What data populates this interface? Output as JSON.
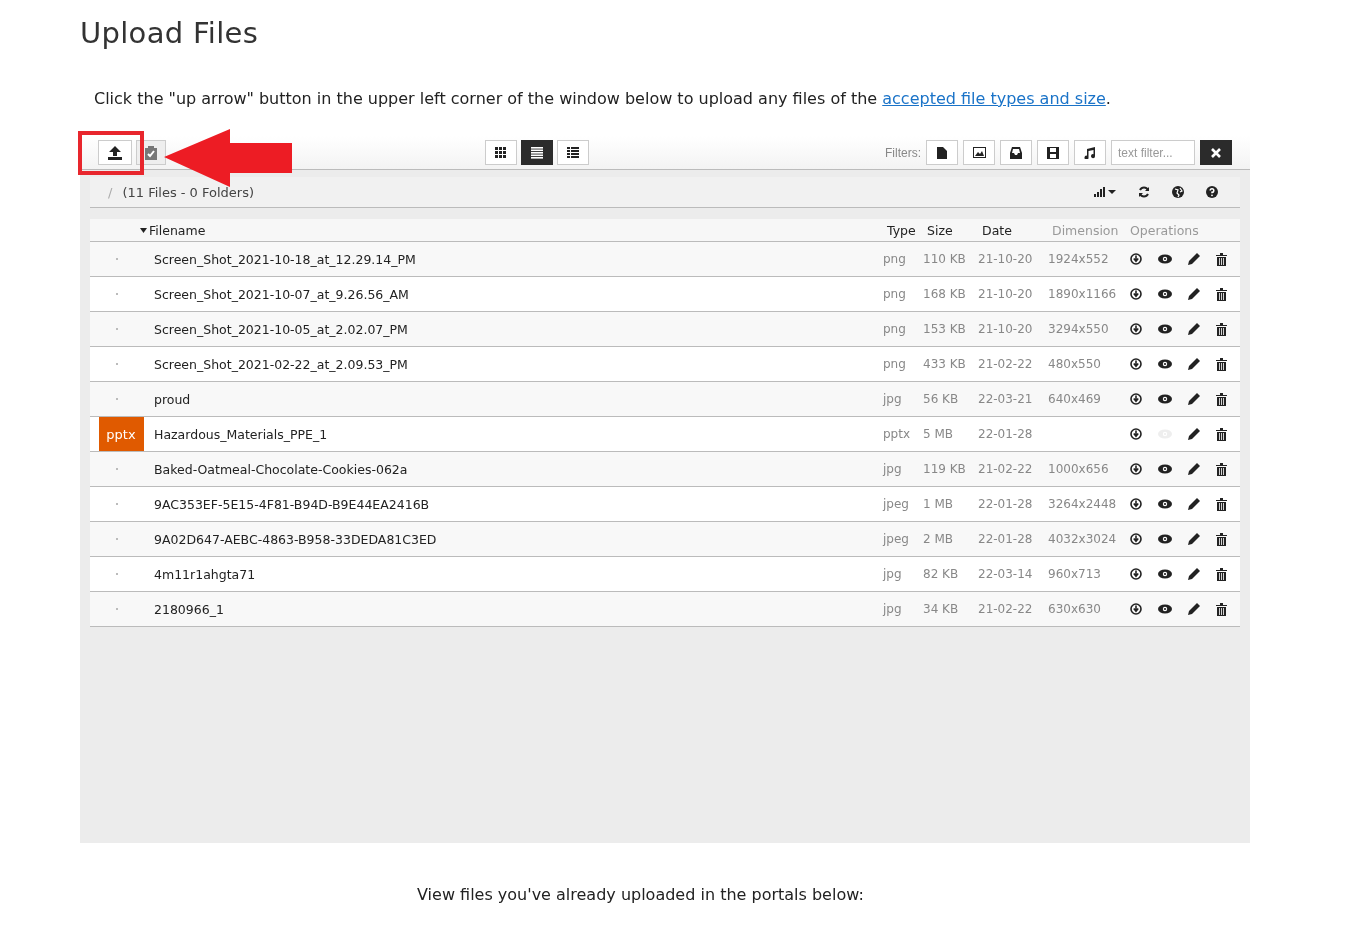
{
  "title": "Upload Files",
  "instruction": {
    "text": "Click the \"up arrow\" button in the upper left corner of the window below to upload any files of the ",
    "link": "accepted file types and size",
    "end": "."
  },
  "toolbar": {
    "view_modes": [
      {
        "kind": "grid",
        "selected": false
      },
      {
        "kind": "list",
        "selected": true
      },
      {
        "kind": "details",
        "selected": false
      }
    ],
    "filters_label": "Filters:",
    "filters": [
      {
        "kind": "file"
      },
      {
        "kind": "image"
      },
      {
        "kind": "archive"
      },
      {
        "kind": "video"
      },
      {
        "kind": "music"
      }
    ],
    "text_filter": {
      "placeholder": "text filter..."
    }
  },
  "path_bar": {
    "separator": "/",
    "summary": "(11 Files - 0 Folders)"
  },
  "table": {
    "columns": [
      {
        "label": "Filename",
        "sorted": true,
        "muted": false
      },
      {
        "label": "Type",
        "sorted": false,
        "muted": false
      },
      {
        "label": "Size",
        "sorted": false,
        "muted": false
      },
      {
        "label": "Date",
        "sorted": false,
        "muted": false
      },
      {
        "label": "Dimension",
        "sorted": false,
        "muted": true
      },
      {
        "label": "Operations",
        "sorted": false,
        "muted": true
      }
    ],
    "rows": [
      {
        "kind": "image",
        "name": "Screen_Shot_2021-10-18_at_12.29.14_PM",
        "type": "png",
        "size": "110 KB",
        "date": "21-10-20",
        "dimension": "1924x552",
        "preview_disabled": false
      },
      {
        "kind": "image",
        "name": "Screen_Shot_2021-10-07_at_9.26.56_AM",
        "type": "png",
        "size": "168 KB",
        "date": "21-10-20",
        "dimension": "1890x1166",
        "preview_disabled": false
      },
      {
        "kind": "image",
        "name": "Screen_Shot_2021-10-05_at_2.02.07_PM",
        "type": "png",
        "size": "153 KB",
        "date": "21-10-20",
        "dimension": "3294x550",
        "preview_disabled": false
      },
      {
        "kind": "image",
        "name": "Screen_Shot_2021-02-22_at_2.09.53_PM",
        "type": "png",
        "size": "433 KB",
        "date": "21-02-22",
        "dimension": "480x550",
        "preview_disabled": false
      },
      {
        "kind": "image",
        "name": "proud",
        "type": "jpg",
        "size": "56 KB",
        "date": "22-03-21",
        "dimension": "640x469",
        "preview_disabled": false
      },
      {
        "kind": "badge",
        "badge": "pptx",
        "name": "Hazardous_Materials_PPE_1",
        "type": "pptx",
        "size": "5 MB",
        "date": "22-01-28",
        "preview_disabled": true
      },
      {
        "kind": "image",
        "name": "Baked-Oatmeal-Chocolate-Cookies-062a",
        "type": "jpg",
        "size": "119 KB",
        "date": "21-02-22",
        "dimension": "1000x656",
        "preview_disabled": false
      },
      {
        "kind": "image",
        "name": "9AC353EF-5E15-4F81-B94D-B9E44EA2416B",
        "type": "jpeg",
        "size": "1 MB",
        "date": "22-01-28",
        "dimension": "3264x2448",
        "preview_disabled": false
      },
      {
        "kind": "image",
        "name": "9A02D647-AEBC-4863-B958-33DEDA81C3ED",
        "type": "jpeg",
        "size": "2 MB",
        "date": "22-01-28",
        "dimension": "4032x3024",
        "preview_disabled": false
      },
      {
        "kind": "image",
        "name": "4m11r1ahgta71",
        "type": "jpg",
        "size": "82 KB",
        "date": "22-03-14",
        "dimension": "960x713",
        "preview_disabled": false
      },
      {
        "kind": "image",
        "name": "2180966_1",
        "type": "jpg",
        "size": "34 KB",
        "date": "21-02-22",
        "dimension": "630x630",
        "preview_disabled": false
      }
    ]
  },
  "footer": "View files you've already uploaded in the portals below:"
}
